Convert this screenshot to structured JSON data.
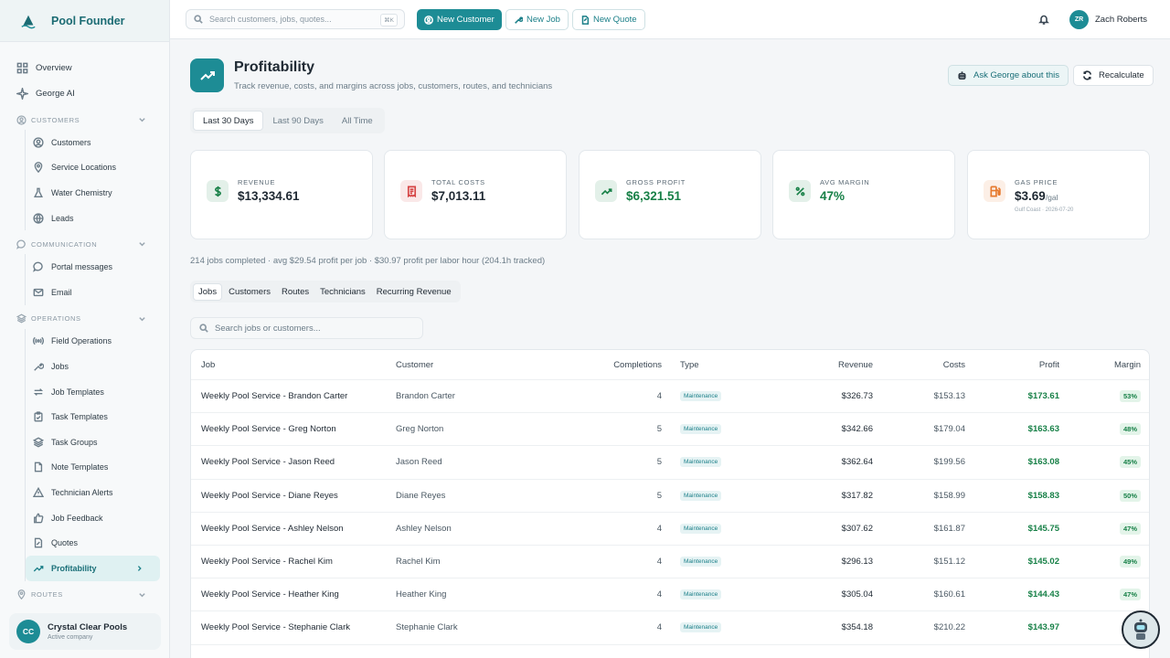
{
  "app": {
    "name": "Pool Founder"
  },
  "sidebar": {
    "top_items": [
      {
        "label": "Overview",
        "icon": "grid-icon"
      },
      {
        "label": "George AI",
        "icon": "sparkle-icon"
      }
    ],
    "sections": [
      {
        "title": "Customers",
        "items": [
          {
            "label": "Customers",
            "icon": "user-circle-icon"
          },
          {
            "label": "Service Locations",
            "icon": "map-pin-icon"
          },
          {
            "label": "Water Chemistry",
            "icon": "flask-icon"
          },
          {
            "label": "Leads",
            "icon": "globe-icon"
          }
        ]
      },
      {
        "title": "Communication",
        "items": [
          {
            "label": "Portal messages",
            "icon": "chat-bubble-icon"
          },
          {
            "label": "Email",
            "icon": "mail-icon"
          }
        ]
      },
      {
        "title": "Operations",
        "items": [
          {
            "label": "Field Operations",
            "icon": "radio-icon"
          },
          {
            "label": "Jobs",
            "icon": "wrench-icon"
          },
          {
            "label": "Job Templates",
            "icon": "repeat-icon"
          },
          {
            "label": "Task Templates",
            "icon": "clipboard-icon"
          },
          {
            "label": "Task Groups",
            "icon": "layers-icon"
          },
          {
            "label": "Note Templates",
            "icon": "file-icon"
          },
          {
            "label": "Technician Alerts",
            "icon": "alert-triangle-icon"
          },
          {
            "label": "Job Feedback",
            "icon": "thumbs-up-icon"
          },
          {
            "label": "Quotes",
            "icon": "quote-doc-icon"
          },
          {
            "label": "Profitability",
            "icon": "trending-up-icon",
            "active": true
          }
        ]
      },
      {
        "title": "Routes",
        "items": []
      }
    ],
    "company": {
      "initials": "CC",
      "name": "Crystal Clear Pools",
      "status": "Active company"
    }
  },
  "topbar": {
    "search_placeholder": "Search customers, jobs, quotes...",
    "shortcut": "⌘K",
    "new_customer": "New Customer",
    "new_job": "New Job",
    "new_quote": "New Quote",
    "user": {
      "initials": "ZR",
      "name": "Zach Roberts"
    }
  },
  "page": {
    "title": "Profitability",
    "subtitle": "Track revenue, costs, and margins across jobs, customers, routes, and technicians",
    "ask_george": "Ask George about this",
    "recalculate": "Recalculate",
    "ranges": [
      "Last 30 Days",
      "Last 90 Days",
      "All Time"
    ],
    "active_range": 0
  },
  "cards": [
    {
      "label": "Revenue",
      "value": "$13,334.61",
      "icon": "dollar-icon",
      "accent": "#178047"
    },
    {
      "label": "Total Costs",
      "value": "$7,013.11",
      "icon": "receipt-icon",
      "accent": "#d64545"
    },
    {
      "label": "Gross Profit",
      "value": "$6,321.51",
      "icon": "trending-up-icon",
      "accent": "#178047"
    },
    {
      "label": "Avg Margin",
      "value": "47%",
      "icon": "percent-icon",
      "accent": "#178047"
    },
    {
      "label": "Gas Price",
      "value": "$3.69",
      "unit": "/gal",
      "meta": "Gulf Coast · 2026-07-20",
      "icon": "fuel-icon",
      "accent": "#e67a2e"
    }
  ],
  "summary": "214 jobs completed · avg $29.54 profit per job  · $30.97 profit per labor hour (204.1h tracked)",
  "tabs": [
    "Jobs",
    "Customers",
    "Routes",
    "Technicians",
    "Recurring Revenue"
  ],
  "active_tab": 0,
  "table_search_placeholder": "Search jobs or customers...",
  "table": {
    "columns": [
      "Job",
      "Customer",
      "Completions",
      "Type",
      "Revenue",
      "Costs",
      "Profit",
      "Margin"
    ],
    "rows": [
      {
        "job": "Weekly Pool Service - Brandon Carter",
        "customer": "Brandon Carter",
        "completions": "4",
        "type": "Maintenance",
        "revenue": "$326.73",
        "costs": "$153.13",
        "profit": "$173.61",
        "margin": "53%"
      },
      {
        "job": "Weekly Pool Service - Greg Norton",
        "customer": "Greg Norton",
        "completions": "5",
        "type": "Maintenance",
        "revenue": "$342.66",
        "costs": "$179.04",
        "profit": "$163.63",
        "margin": "48%"
      },
      {
        "job": "Weekly Pool Service - Jason Reed",
        "customer": "Jason Reed",
        "completions": "5",
        "type": "Maintenance",
        "revenue": "$362.64",
        "costs": "$199.56",
        "profit": "$163.08",
        "margin": "45%"
      },
      {
        "job": "Weekly Pool Service - Diane Reyes",
        "customer": "Diane Reyes",
        "completions": "5",
        "type": "Maintenance",
        "revenue": "$317.82",
        "costs": "$158.99",
        "profit": "$158.83",
        "margin": "50%"
      },
      {
        "job": "Weekly Pool Service - Ashley Nelson",
        "customer": "Ashley Nelson",
        "completions": "4",
        "type": "Maintenance",
        "revenue": "$307.62",
        "costs": "$161.87",
        "profit": "$145.75",
        "margin": "47%"
      },
      {
        "job": "Weekly Pool Service - Rachel Kim",
        "customer": "Rachel Kim",
        "completions": "4",
        "type": "Maintenance",
        "revenue": "$296.13",
        "costs": "$151.12",
        "profit": "$145.02",
        "margin": "49%"
      },
      {
        "job": "Weekly Pool Service - Heather King",
        "customer": "Heather King",
        "completions": "4",
        "type": "Maintenance",
        "revenue": "$305.04",
        "costs": "$160.61",
        "profit": "$144.43",
        "margin": "47%"
      },
      {
        "job": "Weekly Pool Service - Stephanie Clark",
        "customer": "Stephanie Clark",
        "completions": "4",
        "type": "Maintenance",
        "revenue": "$354.18",
        "costs": "$210.22",
        "profit": "$143.97",
        "margin": ""
      }
    ]
  }
}
